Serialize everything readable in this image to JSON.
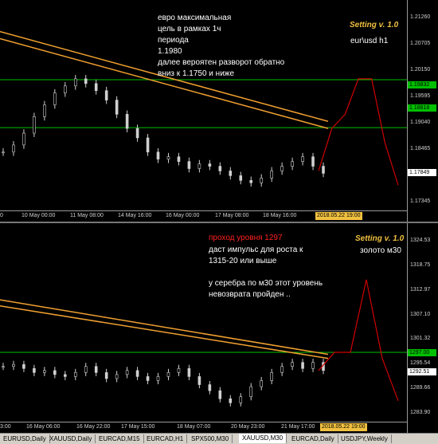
{
  "chart1": {
    "setting_label": "Setting v. 1.0",
    "symbol": "eur\\usd h1",
    "comment": [
      "евро максимальная",
      "цель в рамках 1ч",
      "периода",
      "1.1980",
      "далее вероятен разворот обратно",
      "вниз к 1.1750 и ниже"
    ],
    "price_ticks": [
      "1.21260",
      "1.20705",
      "1.20150",
      "1.19595",
      "1.19040",
      "1.18465",
      "1.17900",
      "1.17345"
    ],
    "price_tags": [
      {
        "label": "1.19832",
        "color": "#00c000"
      },
      {
        "label": "1.18818",
        "color": "#00c000"
      },
      {
        "label": "1.17849",
        "color": "#ffffff"
      }
    ],
    "time_ticks": [
      "0",
      "10 May 00:00",
      "11 May 08:00",
      "14 May 16:00",
      "16 May 00:00",
      "17 May 08:00",
      "18 May 16:00"
    ],
    "time_current": "2018.05.22 19:00"
  },
  "chart2": {
    "setting_label": "Setting v. 1.0",
    "symbol": "золото м30",
    "comment_title": "проход уровня 1297",
    "comment": [
      "даст импульс для роста к",
      "1315-20 или выше",
      "",
      "у серебра по м30 этот уровень",
      "невозврата пройден .."
    ],
    "price_ticks": [
      "1324.53",
      "1318.75",
      "1312.97",
      "1307.10",
      "1301.32",
      "1295.54",
      "1289.66",
      "1283.90"
    ],
    "price_tags": [
      {
        "label": "1297.00",
        "color": "#00c000"
      },
      {
        "label": "1292.51",
        "color": "#ffffff"
      }
    ],
    "time_ticks": [
      "3:00",
      "16 May 06:00",
      "16 May 22:00",
      "17 May 15:00",
      "18 May 07:00",
      "20 May 23:00",
      "21 May 17:00"
    ],
    "time_current": "2018.05.22 19:00"
  },
  "tabs": [
    "EURUSD,Daily",
    "XAUUSD,Daily",
    "EURCAD,M15",
    "EURCAD,H1",
    "SPX500,M30",
    "XAUUSD,M30",
    "EURCAD,Daily",
    "USDJPY,Weekly"
  ],
  "active_tab": "XAUUSD,M30",
  "colors": {
    "ma": "#f0a030",
    "level": "#00c000",
    "projection": "#d00000",
    "candle": "#d0d0d0"
  },
  "chart_data": [
    {
      "type": "candlestick",
      "title": "Setting v. 1.0 eur\\usd h1",
      "ylim": [
        1.1725,
        1.2135
      ],
      "levels": [
        1.19832,
        1.18818
      ],
      "close_path": [
        1.183,
        1.1845,
        1.187,
        1.1905,
        1.193,
        1.1955,
        1.197,
        1.1985,
        1.1975,
        1.196,
        1.194,
        1.191,
        1.188,
        1.186,
        1.183,
        1.1815,
        1.182,
        1.181,
        1.1795,
        1.1805,
        1.18,
        1.179,
        1.178,
        1.177,
        1.1765,
        1.1775,
        1.179,
        1.18,
        1.181,
        1.182,
        1.18,
        1.1785
      ],
      "moving_averages": [
        {
          "start": 1.207,
          "end": 1.188
        },
        {
          "start": 1.2085,
          "end": 1.1895
        }
      ],
      "projection": [
        1.179,
        1.188,
        1.191,
        1.1985,
        1.1985,
        1.185,
        1.176
      ]
    },
    {
      "type": "candlestick",
      "title": "Setting v. 1.0 золото м30",
      "ylim": [
        1282,
        1327
      ],
      "levels": [
        1297.0
      ],
      "close_path": [
        1293.5,
        1294.0,
        1293.0,
        1292.0,
        1292.5,
        1291.5,
        1291.0,
        1292.0,
        1293.5,
        1292.0,
        1290.5,
        1291.5,
        1292.5,
        1291.0,
        1290.0,
        1291.0,
        1292.0,
        1293.0,
        1291.0,
        1289.0,
        1287.5,
        1285.5,
        1284.5,
        1286.0,
        1288.5,
        1290.0,
        1292.0,
        1293.5,
        1294.5,
        1293.0,
        1294.5,
        1292.5
      ],
      "moving_averages": [
        {
          "start": 1308.5,
          "end": 1295.5
        },
        {
          "start": 1310.0,
          "end": 1296.5
        }
      ],
      "projection": [
        1292.5,
        1297.0,
        1297.0,
        1315.0,
        1295.5,
        1285.0
      ]
    }
  ]
}
